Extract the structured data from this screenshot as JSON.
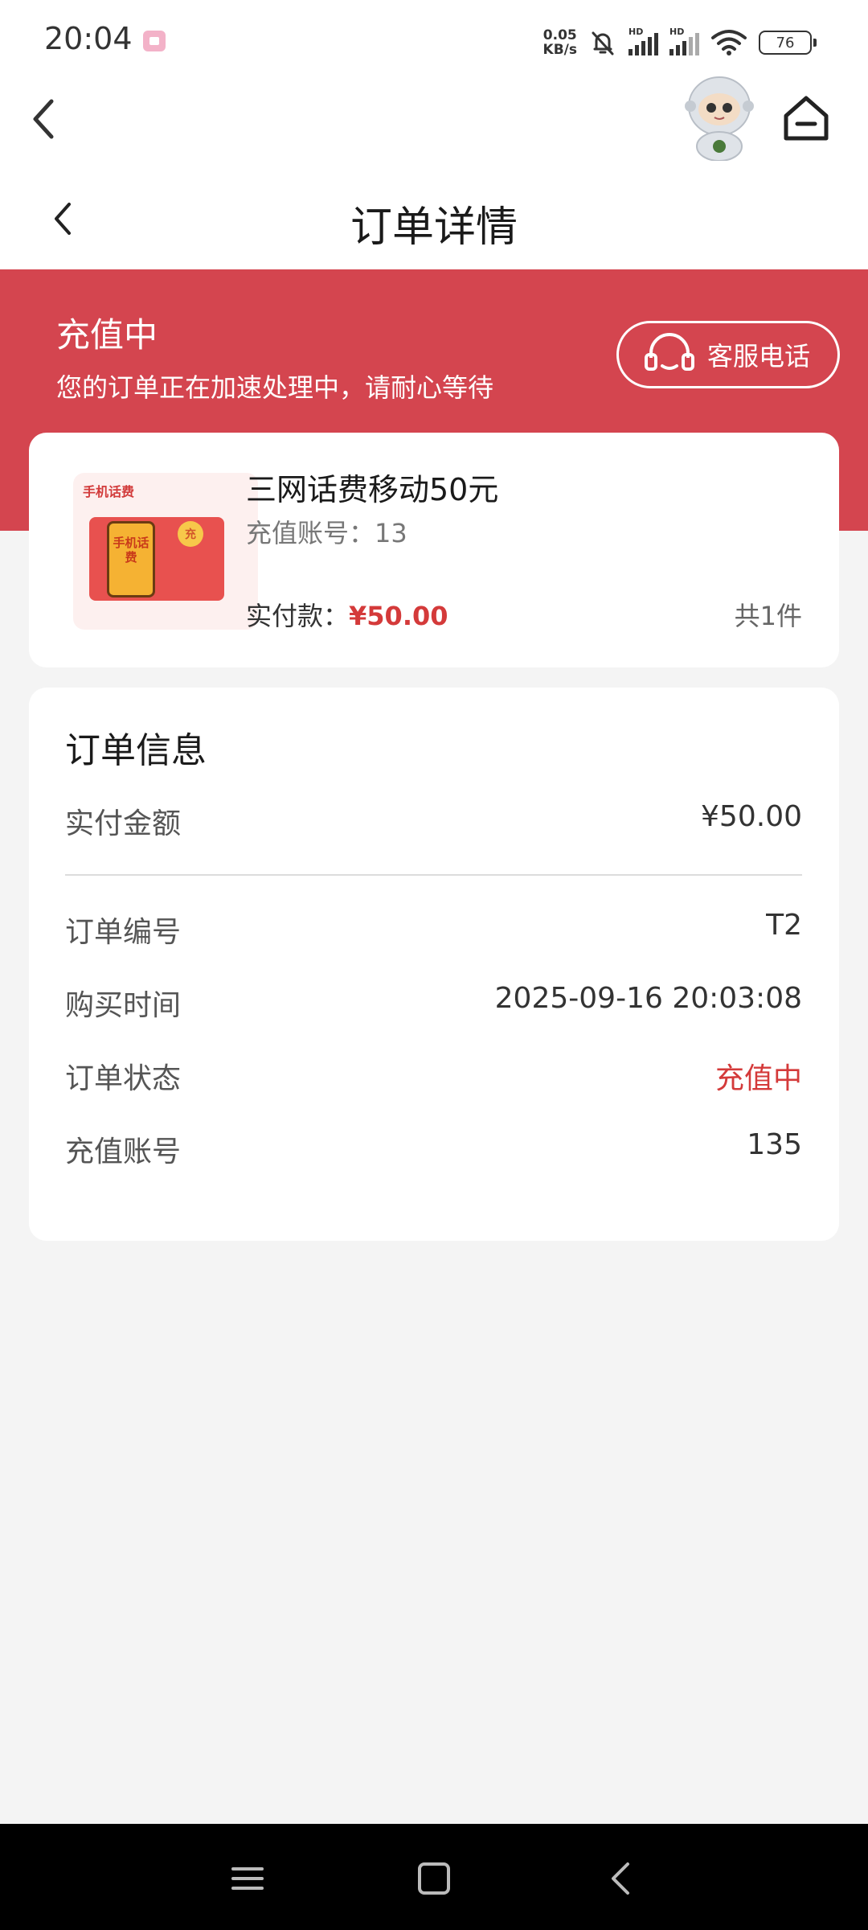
{
  "status_bar": {
    "time": "20:04",
    "net_speed_value": "0.05",
    "net_speed_unit": "KB/s",
    "hd_label_1": "HD",
    "hd_label_2": "HD",
    "battery": "76"
  },
  "top_nav": {
    "back_icon": "chevron-left-icon",
    "robot_icon": "robot-mascot-icon",
    "home_icon": "home-icon"
  },
  "header": {
    "title": "订单详情"
  },
  "banner": {
    "status": "充值中",
    "subtitle": "您的订单正在加速处理中，请耐心等待",
    "service_button_label": "客服电话",
    "background_color": "#d4454f"
  },
  "product": {
    "image_label": "手机话费",
    "image_phone_text": "手机话费",
    "image_coin": "充",
    "title": "三网话费移动50元",
    "account_label": "充值账号：",
    "account_value": "13",
    "paid_label": "实付款：",
    "paid_amount": "¥50.00",
    "quantity": "共1件"
  },
  "order_info": {
    "title": "订单信息",
    "amount_label": "实付金额",
    "amount_value": "¥50.00",
    "rows": [
      {
        "label": "订单编号",
        "value": "T2"
      },
      {
        "label": "购买时间",
        "value": "2025-09-16 20:03:08"
      },
      {
        "label": "订单状态",
        "value": "充值中"
      },
      {
        "label": "充值账号",
        "value": "135"
      }
    ],
    "accent_color": "#d43a3a"
  }
}
